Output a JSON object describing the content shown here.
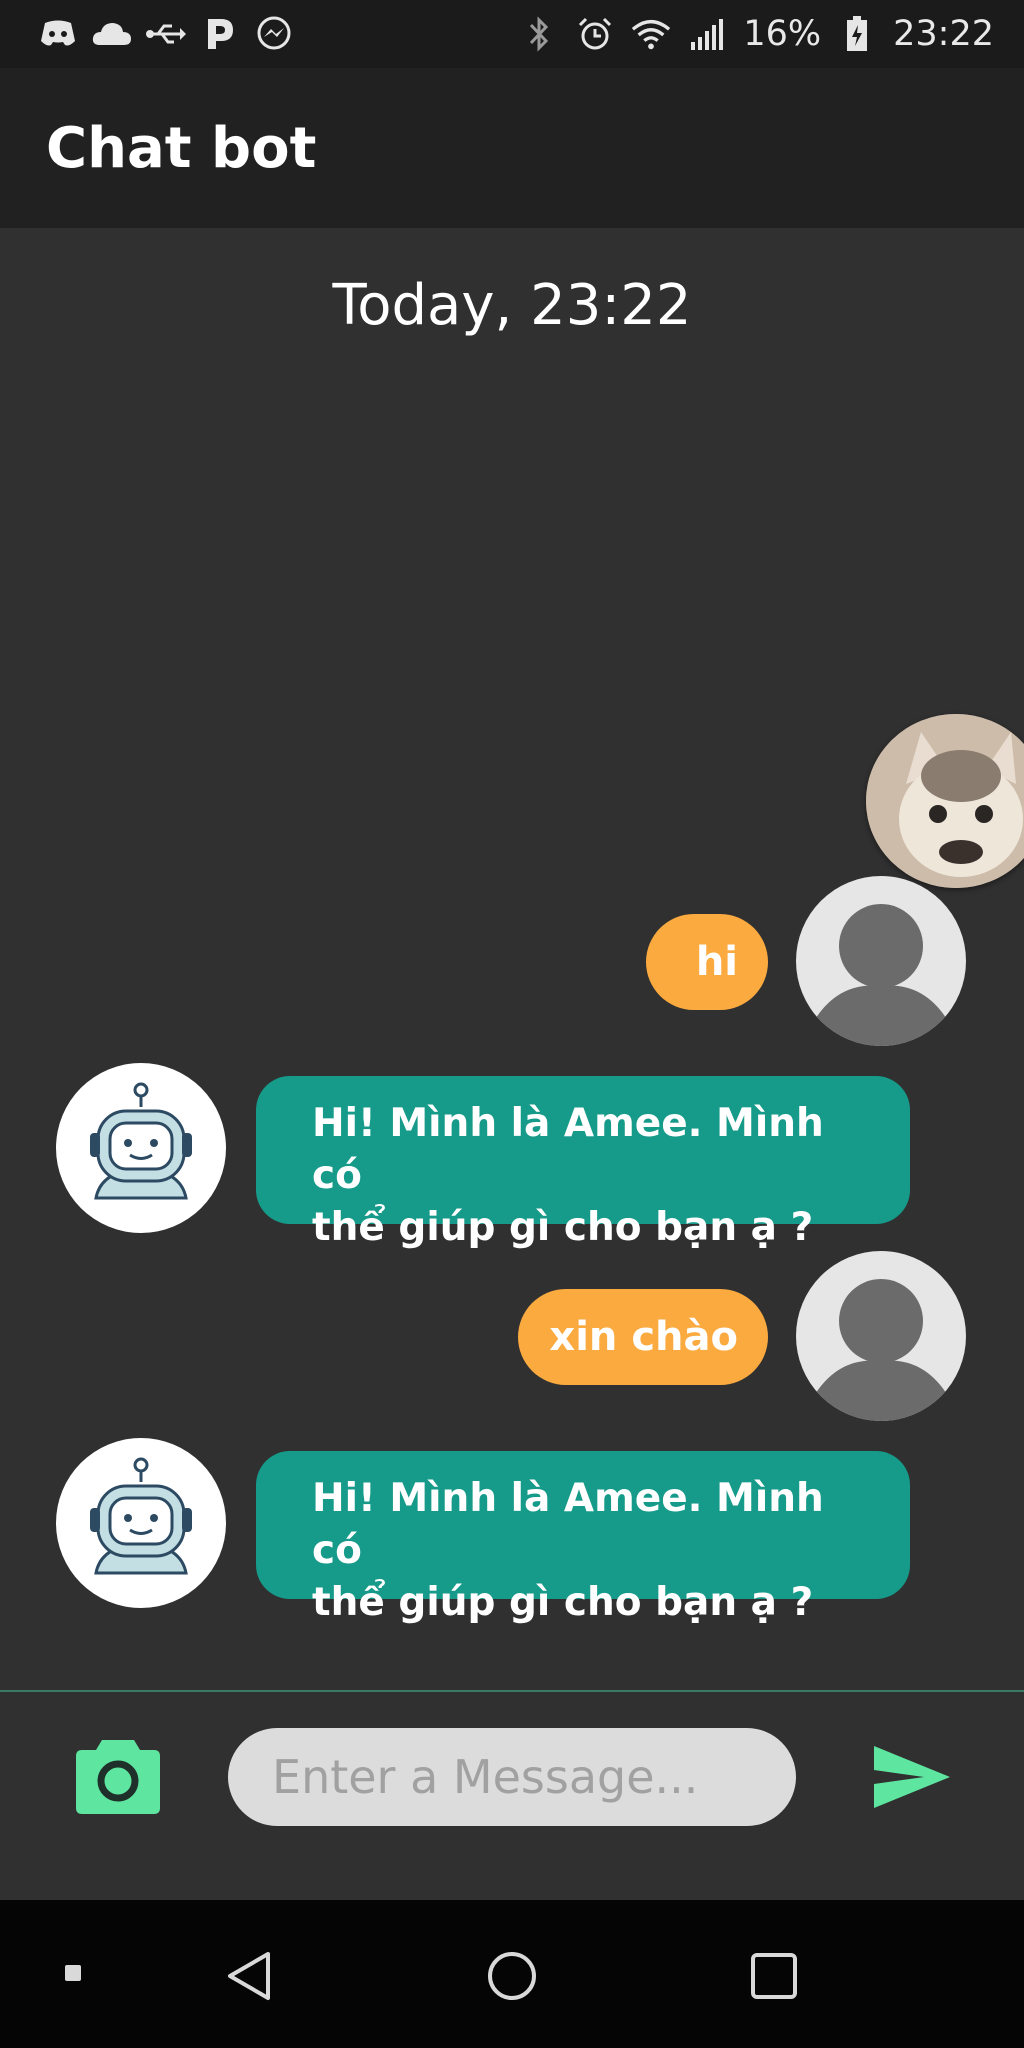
{
  "status_bar": {
    "left_icons": [
      "discord-icon",
      "cloud-icon",
      "usb-icon",
      "pandora-icon",
      "messenger-icon"
    ],
    "right_icons": [
      "bluetooth-icon",
      "alarm-icon",
      "wifi-icon",
      "signal-icon",
      "battery-charging-icon"
    ],
    "battery_percent": "16%",
    "time": "23:22"
  },
  "app_bar": {
    "title": "Chat bot"
  },
  "chat": {
    "date_label": "Today, 23:22",
    "messages": [
      {
        "sender": "user",
        "text": "hi"
      },
      {
        "sender": "bot",
        "text_line1": "Hi! Mình là Amee. Mình có",
        "text_line2": "thể giúp gì cho bạn ạ ?"
      },
      {
        "sender": "user",
        "text": "xin chào"
      },
      {
        "sender": "bot",
        "text_line1": "Hi! Mình là Amee. Mình có",
        "text_line2": "thể giúp gì cho bạn ạ ?"
      }
    ]
  },
  "input_bar": {
    "placeholder": "Enter a Message...",
    "camera_icon": "camera-icon",
    "send_icon": "send-icon"
  },
  "nav_bar": {
    "icons": [
      "recents-dot-icon",
      "back-icon",
      "home-icon",
      "overview-icon"
    ]
  },
  "colors": {
    "background": "#303030",
    "app_bar": "#212121",
    "user_bubble": "#fbaa40",
    "bot_bubble": "#169a89",
    "accent": "#5ee6a0"
  }
}
